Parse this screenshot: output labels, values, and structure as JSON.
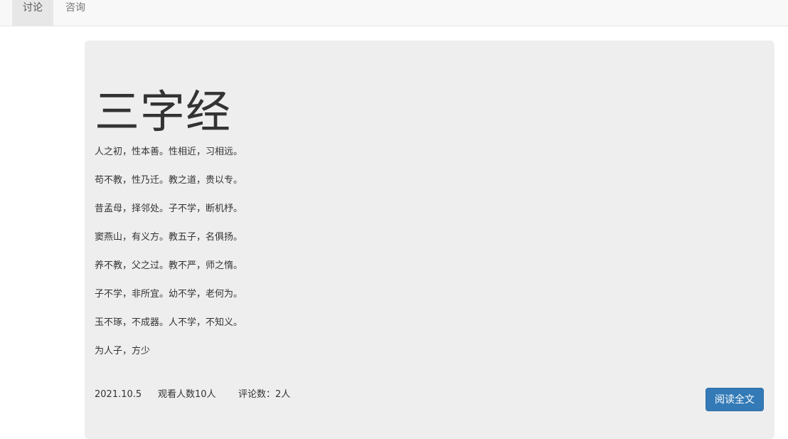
{
  "nav": {
    "tabs": [
      {
        "label": "讨论",
        "active": true
      },
      {
        "label": "咨询",
        "active": false
      }
    ]
  },
  "article": {
    "title": "三字经",
    "lines": [
      "人之初，性本善。性相近，习相远。",
      "苟不教，性乃迁。教之道，贵以专。",
      "昔孟母，择邻处。子不学，断机杼。",
      "窦燕山，有义方。教五子，名俱扬。",
      "养不教，父之过。教不严，师之惰。",
      "子不学，非所宜。幼不学，老何为。",
      "玉不琢，不成器。人不学，不知义。",
      "为人子，方少"
    ],
    "date": "2021.10.5",
    "views": "观看人数10人",
    "comments": "评论数：2人",
    "read_button": "阅读全文"
  },
  "colors": {
    "navbar_bg": "#f8f8f8",
    "active_tab_bg": "#e7e7e7",
    "panel_bg": "#eeeeee",
    "button_bg": "#337ab7"
  }
}
